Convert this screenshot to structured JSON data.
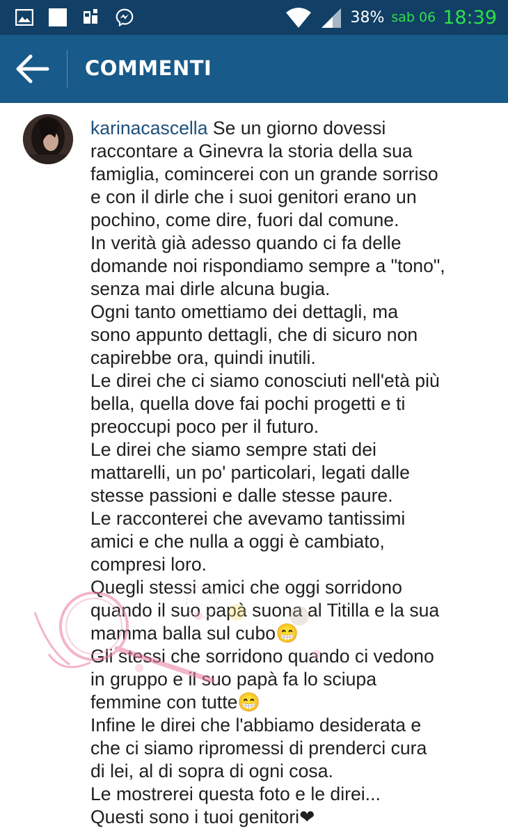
{
  "status_bar": {
    "battery": "38%",
    "date": "sab 06",
    "time": "18:39",
    "icons": [
      "gallery-icon",
      "notification-square-icon",
      "sim-icon",
      "messenger-icon",
      "wifi-icon",
      "signal-icon"
    ]
  },
  "header": {
    "back_icon": "arrow-left-icon",
    "title": "COMMENTI"
  },
  "comment": {
    "username": "karinacascella",
    "first_line_text": "Se un giorno dovessi",
    "lines": [
      "raccontare a Ginevra la storia della sua",
      "famiglia, comincerei con un grande sorriso",
      "e con il dirle che i suoi genitori erano un",
      "pochino, come dire, fuori dal comune.",
      "In verità già adesso quando ci fa delle",
      "domande noi rispondiamo sempre a \"tono\",",
      "senza mai dirle alcuna bugia.",
      "Ogni tanto omettiamo dei dettagli, ma",
      "sono appunto dettagli, che di sicuro non",
      "capirebbe ora, quindi inutili.",
      "Le direi che ci siamo conosciuti nell'età più",
      "bella, quella dove fai pochi progetti e ti",
      "preoccupi poco per il futuro.",
      "Le direi che siamo sempre stati dei",
      "mattarelli, un po' particolari, legati dalle",
      "stesse passioni e dalle stesse paure.",
      "Le racconterei che avevamo tantissimi",
      "amici e che nulla a oggi è cambiato,",
      "compresi loro.",
      "Quegli stessi amici che oggi sorridono",
      "quando il suo papà suona al Titilla e la sua",
      "mamma balla sul cubo😁",
      "Gli stessi che sorridono quando ci vedono",
      "in gruppo e il suo papà fa lo sciupa",
      "femmine con tutte😁",
      "Infine le direi che l'abbiamo desiderata e",
      "che ci siamo ripromessi di prenderci cura",
      "di lei, al di sopra di ogni cosa.",
      "Le mostrerei questa foto e le direi...",
      "Questi sono i tuoi genitori❤"
    ]
  },
  "colors": {
    "status_bar": "#113f65",
    "header": "#185a89",
    "username": "#1e4f7b",
    "clock": "#2fe04a",
    "watermark": "#e9799f"
  }
}
